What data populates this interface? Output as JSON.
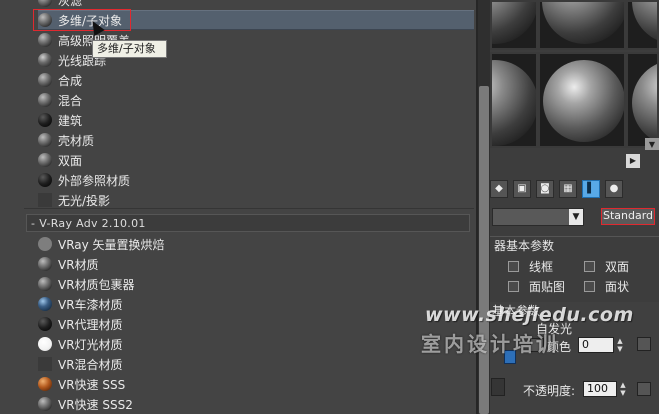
{
  "browser": {
    "items": [
      {
        "label": "灰滤",
        "ball": "normal"
      },
      {
        "label": "多维/子对象",
        "ball": "normal",
        "selected": true
      },
      {
        "label": "高级照明覆盖",
        "ball": "normal"
      },
      {
        "label": "光线跟踪",
        "ball": "ray"
      },
      {
        "label": "合成",
        "ball": "normal"
      },
      {
        "label": "混合",
        "ball": "normal"
      },
      {
        "label": "建筑",
        "ball": "dark"
      },
      {
        "label": "壳材质",
        "ball": "normal"
      },
      {
        "label": "双面",
        "ball": "normal"
      },
      {
        "label": "外部参照材质",
        "ball": "dark"
      },
      {
        "label": "无光/投影",
        "ball": "square"
      }
    ],
    "group_header": "V-Ray Adv 2.10.01",
    "vray_items": [
      {
        "label": "VRay 矢量置换烘焙",
        "ball": "flat"
      },
      {
        "label": "VR材质",
        "ball": "normal"
      },
      {
        "label": "VR材质包裹器",
        "ball": "normal"
      },
      {
        "label": "VR车漆材质",
        "ball": "car"
      },
      {
        "label": "VR代理材质",
        "ball": "dark"
      },
      {
        "label": "VR灯光材质",
        "ball": "white"
      },
      {
        "label": "VR混合材质",
        "ball": "square"
      },
      {
        "label": "VR快速 SSS",
        "ball": "sss"
      },
      {
        "label": "VR快速 SSS2",
        "ball": "normal"
      }
    ],
    "tooltip": "多维/子对象"
  },
  "toolbar": {
    "icons": [
      "material-effects-icon",
      "put-to-library-icon",
      "show-map-icon",
      "checker-background-icon",
      "backlight-icon",
      "sample-uv-icon"
    ]
  },
  "editor": {
    "material_type_button": "Standard",
    "rollout_title": "器基本参数",
    "wire_label": "线框",
    "two_sided_label": "双面",
    "face_map_label": "面贴图",
    "faceted_label": "面状",
    "shader_partial": "基本参数",
    "self_illum_label": "自发光",
    "color_label": "颜色",
    "color_value": "0",
    "opacity_label": "不透明度:",
    "opacity_value": "100"
  },
  "watermark": {
    "url": "www.shejiedu.com",
    "cn": "室内设计培训"
  }
}
